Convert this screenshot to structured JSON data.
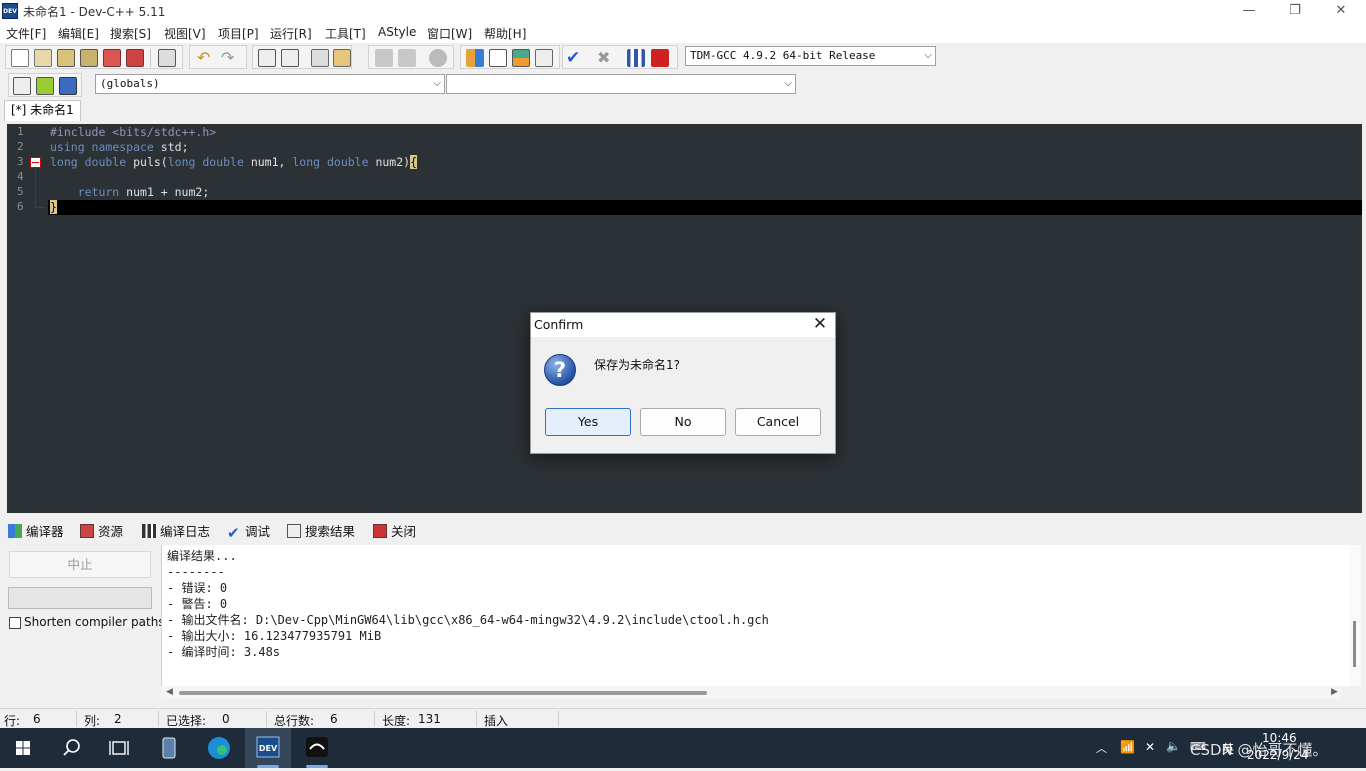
{
  "window": {
    "app_icon": "DEV",
    "title": "未命名1 - Dev-C++ 5.11",
    "minimize": "—",
    "maximize": "❐",
    "close": "✕"
  },
  "menu": [
    "文件[F]",
    "编辑[E]",
    "搜索[S]",
    "视图[V]",
    "项目[P]",
    "运行[R]",
    "工具[T]",
    "AStyle",
    "窗口[W]",
    "帮助[H]"
  ],
  "toolbar": {
    "compiler_select": "TDM-GCC 4.9.2 64-bit Release",
    "scope_select": "(globals)",
    "function_select": ""
  },
  "file_tab": "[*] 未命名1",
  "editor": {
    "line_numbers": [
      "1",
      "2",
      "3",
      "4",
      "5",
      "6"
    ],
    "lines": [
      [
        {
          "t": "#include <bits/stdc++.h>",
          "c": "pp"
        }
      ],
      [
        {
          "t": "using ",
          "c": "kw"
        },
        {
          "t": "namespace ",
          "c": "kw"
        },
        {
          "t": "std;",
          "c": "tx"
        }
      ],
      [
        {
          "t": "long double ",
          "c": "kw"
        },
        {
          "t": "puls(",
          "c": "tx"
        },
        {
          "t": "long double ",
          "c": "kw"
        },
        {
          "t": "num1, ",
          "c": "tx"
        },
        {
          "t": "long double ",
          "c": "kw"
        },
        {
          "t": "num2)",
          "c": "tx"
        },
        {
          "t": "{",
          "c": "brace-hl"
        }
      ],
      [],
      [
        {
          "t": "    return ",
          "c": "kw"
        },
        {
          "t": "num1 + num2;",
          "c": "tx"
        }
      ],
      [
        {
          "t": "}",
          "c": "brace-hl"
        }
      ]
    ]
  },
  "bottom_tabs": {
    "compiler": "编译器",
    "resources": "资源",
    "compile_log": "编译日志",
    "debug": "调试",
    "search_results": "搜索结果",
    "close": "关闭"
  },
  "compile_panel": {
    "abort": "中止",
    "shorten_paths": "Shorten compiler paths",
    "log": [
      "编译结果...",
      "--------",
      "- 错误: 0",
      "- 警告: 0",
      "- 输出文件名: D:\\Dev-Cpp\\MinGW64\\lib\\gcc\\x86_64-w64-mingw32\\4.9.2\\include\\ctool.h.gch",
      "- 输出大小: 16.123477935791 MiB",
      "- 编译时间: 3.48s"
    ]
  },
  "status": {
    "row_label": "行:",
    "row": "6",
    "col_label": "列:",
    "col": "2",
    "sel_label": "已选择:",
    "sel": "0",
    "lines_label": "总行数:",
    "lines": "6",
    "len_label": "长度:",
    "len": "131",
    "mode": "插入"
  },
  "dialog": {
    "title": "Confirm",
    "icon": "?",
    "message": "保存为未命名1?",
    "yes": "Yes",
    "no": "No",
    "cancel": "Cancel",
    "close": "✕"
  },
  "taskbar": {
    "time": "10:46",
    "date": "2022/9/24",
    "lang": "英",
    "watermark": "CSDN @怡哥不懂。"
  }
}
